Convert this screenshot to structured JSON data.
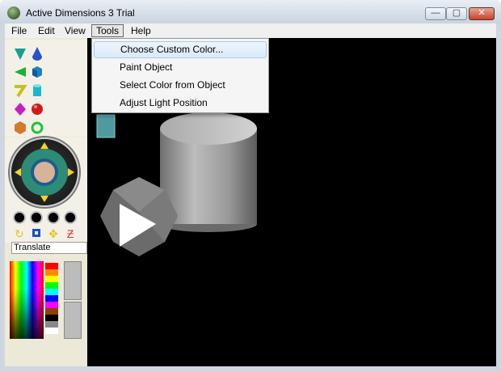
{
  "window": {
    "title": "Active Dimensions 3 Trial"
  },
  "controls": {
    "minimize": "—",
    "maximize": "▢",
    "close": "✕"
  },
  "menubar": {
    "items": [
      {
        "label": "File"
      },
      {
        "label": "Edit"
      },
      {
        "label": "View"
      },
      {
        "label": "Tools"
      },
      {
        "label": "Help"
      }
    ]
  },
  "tools_menu": {
    "items": [
      {
        "label": "Choose Custom Color..."
      },
      {
        "label": "Paint Object"
      },
      {
        "label": "Select Color from Object"
      },
      {
        "label": "Adjust Light Position"
      }
    ]
  },
  "navigation": {
    "mode_label": "Translate"
  },
  "colors": {
    "accent": "#2d8c78",
    "background": "#000000",
    "menu_highlight": "#dbeaf9"
  },
  "icons": [
    "cone-icon",
    "drop-icon",
    "wedge-icon",
    "cube-icon",
    "bent-pipe-icon",
    "cylinder-icon",
    "diamond-icon",
    "sphere-icon",
    "dodecahedron-icon",
    "torus-icon",
    "rotate-icon",
    "scale-icon",
    "move-icon",
    "twist-icon"
  ]
}
